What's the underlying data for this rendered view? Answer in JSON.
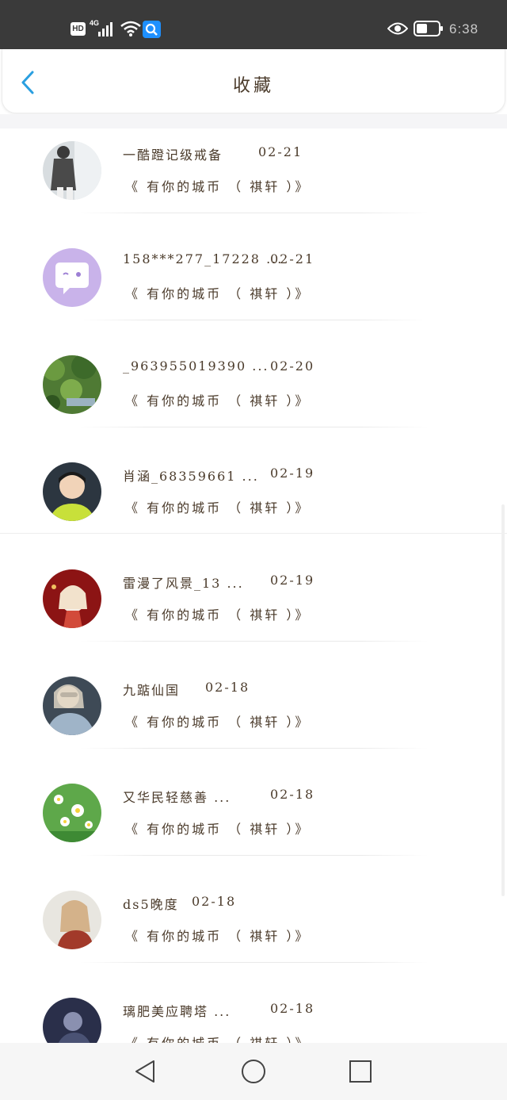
{
  "status_bar": {
    "hd_label": "HD",
    "network_label": "4G",
    "time": "6:38",
    "colors": {
      "background": "#3a3a3a",
      "search_badge": "#1e90ff"
    }
  },
  "header": {
    "title": "收藏",
    "back_icon": "chevron-left-icon",
    "accent_color": "#2a9fe0"
  },
  "items": [
    {
      "name": "一酷蹬记级戒备",
      "date": "02-21",
      "sub": "《 有你的城币 （ 祺轩 ）》",
      "avatar": "avatar-boy-photo"
    },
    {
      "name": "158***277_17228 ...",
      "date": "02-21",
      "sub": "《 有你的城币 （ 祺轩 ）》",
      "avatar": "avatar-default-purple"
    },
    {
      "name": "_963955019390 ...",
      "date": "02-20",
      "sub": "《 有你的城币 （ 祺轩 ）》",
      "avatar": "avatar-forest"
    },
    {
      "name": "肖涵_68359661 ...",
      "date": "02-19",
      "sub": "《 有你的城币 （ 祺轩 ）》",
      "avatar": "avatar-boy-smiling"
    },
    {
      "name": "雷漫了风景_13 ...",
      "date": "02-19",
      "sub": "《 有你的城币 （ 祺轩 ）》",
      "avatar": "avatar-anime-red"
    },
    {
      "name": "九踮仙国",
      "date": "02-18",
      "sub": "《 有你的城币 （ 祺轩 ）》",
      "avatar": "avatar-sunglasses"
    },
    {
      "name": "又华民轻慈善 ...",
      "date": "02-18",
      "sub": "《 有你的城币 （ 祺轩 ）》",
      "avatar": "avatar-daisies"
    },
    {
      "name": "ds5晚度",
      "date": "02-18",
      "sub": "《 有你的城币 （ 祺轩 ）》",
      "avatar": "avatar-girl-drawing"
    },
    {
      "name": "璃肥美应聘塔 ...",
      "date": "02-18",
      "sub": "《 有你的城币 （ 祺轩 ）》",
      "avatar": "avatar-night-photo"
    }
  ],
  "nav_bar": {
    "back_icon": "triangle-back-icon",
    "home_icon": "circle-home-icon",
    "recents_icon": "square-recents-icon"
  }
}
